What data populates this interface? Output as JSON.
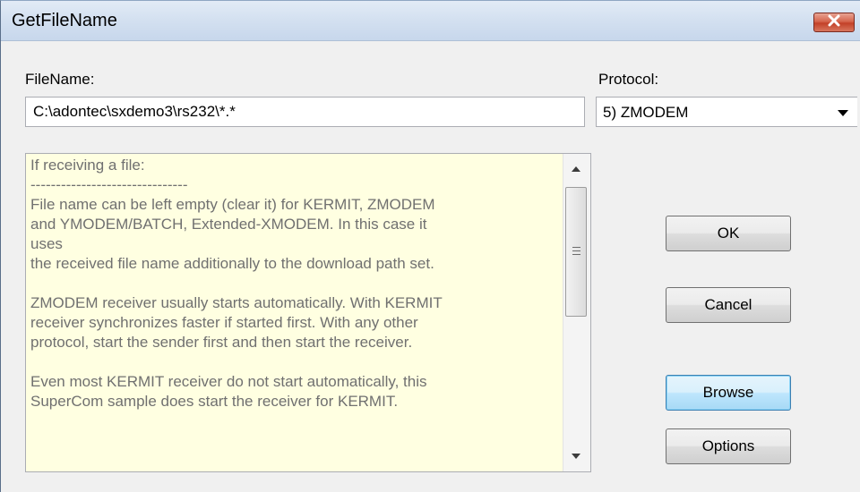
{
  "window": {
    "title": "GetFileName",
    "close_icon": "close-icon"
  },
  "filename": {
    "label": "FileName:",
    "value": "C:\\adontec\\sxdemo3\\rs232\\*.*"
  },
  "protocol": {
    "label": "Protocol:",
    "selected": "5) ZMODEM"
  },
  "info": {
    "lines": [
      "If receiving a file:",
      "-------------------------------",
      "File name can be left empty (clear it) for KERMIT, ZMODEM",
      "and YMODEM/BATCH, Extended-XMODEM. In this case it",
      "uses",
      "the received file name additionally to the download path set.",
      "",
      "ZMODEM receiver usually starts automatically. With KERMIT",
      "receiver synchronizes faster if started first. With any other",
      "protocol, start the sender first and then start the receiver.",
      "",
      "Even most KERMIT receiver do not start automatically, this",
      "SuperCom sample does start the receiver for KERMIT."
    ]
  },
  "buttons": {
    "ok": "OK",
    "cancel": "Cancel",
    "browse": "Browse",
    "options": "Options"
  },
  "colors": {
    "info_background": "#ffffe1",
    "close_button": "#c34128",
    "focused_button": "#bee6fd"
  }
}
